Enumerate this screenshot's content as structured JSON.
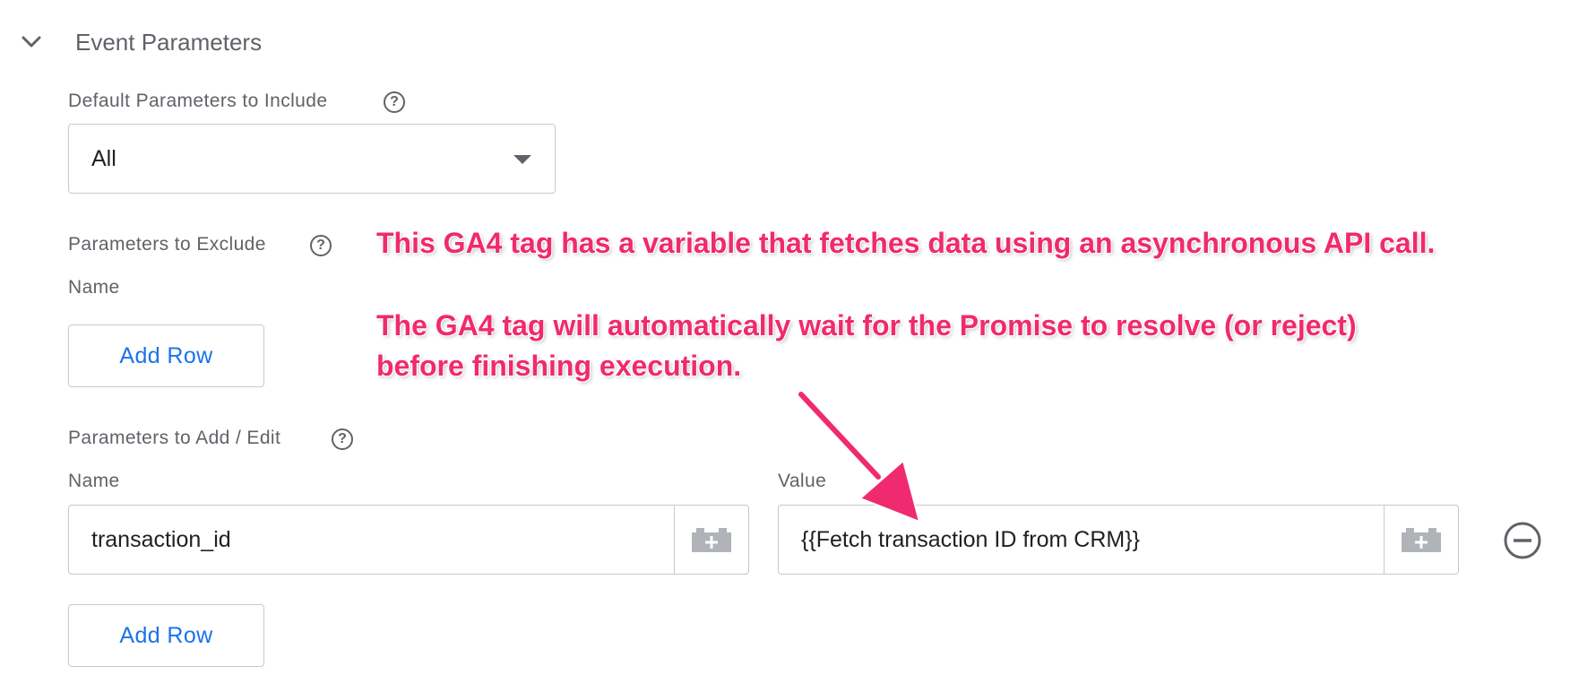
{
  "section": {
    "title": "Event Parameters"
  },
  "default_params": {
    "label": "Default Parameters to Include",
    "selected": "All"
  },
  "exclude": {
    "label": "Parameters to Exclude",
    "name_label": "Name",
    "add_row_label": "Add Row"
  },
  "add_edit": {
    "label": "Parameters to Add / Edit",
    "name_label": "Name",
    "value_label": "Value",
    "rows": [
      {
        "name": "transaction_id",
        "value": "{{Fetch transaction ID from CRM}}"
      }
    ],
    "add_row_label": "Add Row"
  },
  "annotation": {
    "line1": "This GA4 tag has a variable that fetches data using an asynchronous API call.",
    "line2": "The GA4 tag will automatically wait for the Promise to resolve (or reject)",
    "line3": "before finishing execution.",
    "color": "#f02a6e"
  },
  "icons": {
    "collapse": "chevron-down-icon",
    "help": "help-circle-icon",
    "variable": "variable-brick-icon",
    "remove": "remove-circle-icon",
    "arrow": "annotation-arrow"
  }
}
